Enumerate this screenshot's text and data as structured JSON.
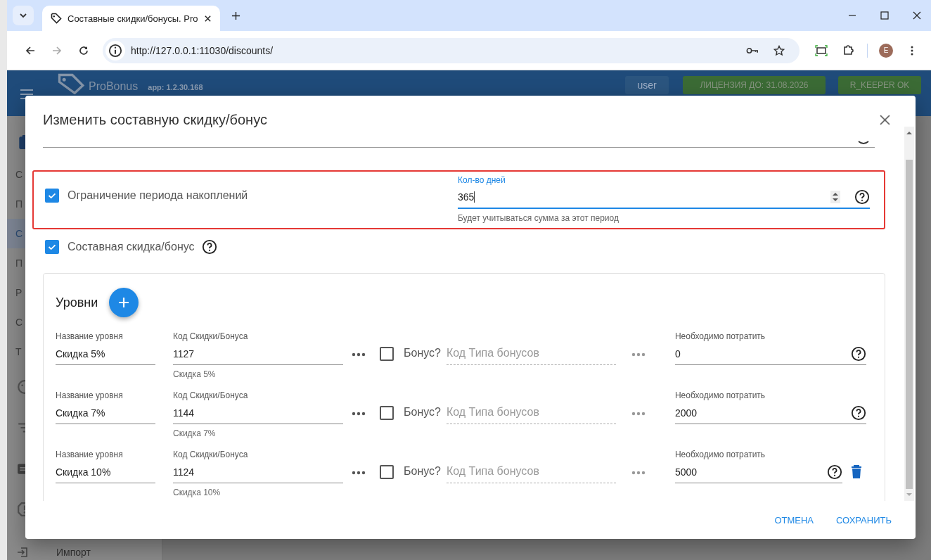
{
  "browser": {
    "tab_title": "Составные скидки/бонусы. Pro",
    "url": "http://127.0.0.1:11030/discounts/",
    "avatar": "E"
  },
  "app_header": {
    "logo": "ProBonus",
    "version": "app: 1.2.30.168",
    "user": "user",
    "license": "ЛИЦЕНЗИЯ ДО: 31.08.2026",
    "status": "R_KEEPER OK"
  },
  "sidebar": {
    "items": [
      {
        "label": "С",
        "selected": false
      },
      {
        "label": "П",
        "selected": false
      },
      {
        "label": "С",
        "selected": true
      },
      {
        "label": "П",
        "selected": false
      },
      {
        "label": "Р",
        "selected": false
      },
      {
        "label": "С",
        "selected": false
      },
      {
        "label": "Т",
        "selected": false
      }
    ],
    "bottom_item": "Импорт"
  },
  "dialog": {
    "title": "Изменить составную скидку/бонус",
    "period_limit": {
      "label": "Ограничение периода накоплений",
      "checked": true,
      "highlighted": true,
      "days_field": {
        "label": "Кол-во дней",
        "value": "365",
        "hint": "Будет учитываться сумма за этот период"
      }
    },
    "composite": {
      "label": "Составная скидка/бонус",
      "checked": true
    },
    "levels": {
      "title": "Уровни",
      "rows": [
        {
          "name_label": "Название уровня",
          "name": "Скидка 5%",
          "code_label": "Код Скидки/Бонуса",
          "code": "1127",
          "code_hint": "Скидка 5%",
          "bonus_label": "Бонус?",
          "bonus_checked": false,
          "bonus_type_placeholder": "Код Типа бонусов",
          "spend_label": "Необходимо потратить",
          "spend": "0",
          "deletable": false
        },
        {
          "name_label": "Название уровня",
          "name": "Скидка 7%",
          "code_label": "Код Скидки/Бонуса",
          "code": "1144",
          "code_hint": "Скидка 7%",
          "bonus_label": "Бонус?",
          "bonus_checked": false,
          "bonus_type_placeholder": "Код Типа бонусов",
          "spend_label": "Необходимо потратить",
          "spend": "2000",
          "deletable": false
        },
        {
          "name_label": "Название уровня",
          "name": "Скидка 10%",
          "code_label": "Код Скидки/Бонуса",
          "code": "1124",
          "code_hint": "Скидка 10%",
          "bonus_label": "Бонус?",
          "bonus_checked": false,
          "bonus_type_placeholder": "Код Типа бонусов",
          "spend_label": "Необходимо потратить",
          "spend": "5000",
          "deletable": true
        }
      ]
    },
    "buttons": [
      {
        "label": "ОТМЕНА"
      },
      {
        "label": "СОХРАНИТЬ"
      }
    ]
  }
}
